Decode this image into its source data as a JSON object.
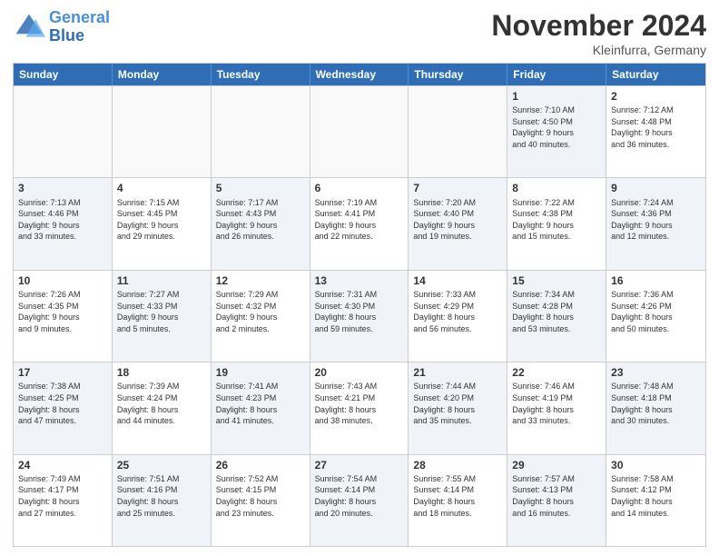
{
  "header": {
    "logo_line1": "General",
    "logo_line2": "Blue",
    "month_title": "November 2024",
    "location": "Kleinfurra, Germany"
  },
  "weekdays": [
    "Sunday",
    "Monday",
    "Tuesday",
    "Wednesday",
    "Thursday",
    "Friday",
    "Saturday"
  ],
  "rows": [
    [
      {
        "day": "",
        "info": "",
        "empty": true
      },
      {
        "day": "",
        "info": "",
        "empty": true
      },
      {
        "day": "",
        "info": "",
        "empty": true
      },
      {
        "day": "",
        "info": "",
        "empty": true
      },
      {
        "day": "",
        "info": "",
        "empty": true
      },
      {
        "day": "1",
        "info": "Sunrise: 7:10 AM\nSunset: 4:50 PM\nDaylight: 9 hours\nand 40 minutes.",
        "shaded": true
      },
      {
        "day": "2",
        "info": "Sunrise: 7:12 AM\nSunset: 4:48 PM\nDaylight: 9 hours\nand 36 minutes.",
        "shaded": false
      }
    ],
    [
      {
        "day": "3",
        "info": "Sunrise: 7:13 AM\nSunset: 4:46 PM\nDaylight: 9 hours\nand 33 minutes.",
        "shaded": true
      },
      {
        "day": "4",
        "info": "Sunrise: 7:15 AM\nSunset: 4:45 PM\nDaylight: 9 hours\nand 29 minutes.",
        "shaded": false
      },
      {
        "day": "5",
        "info": "Sunrise: 7:17 AM\nSunset: 4:43 PM\nDaylight: 9 hours\nand 26 minutes.",
        "shaded": true
      },
      {
        "day": "6",
        "info": "Sunrise: 7:19 AM\nSunset: 4:41 PM\nDaylight: 9 hours\nand 22 minutes.",
        "shaded": false
      },
      {
        "day": "7",
        "info": "Sunrise: 7:20 AM\nSunset: 4:40 PM\nDaylight: 9 hours\nand 19 minutes.",
        "shaded": true
      },
      {
        "day": "8",
        "info": "Sunrise: 7:22 AM\nSunset: 4:38 PM\nDaylight: 9 hours\nand 15 minutes.",
        "shaded": false
      },
      {
        "day": "9",
        "info": "Sunrise: 7:24 AM\nSunset: 4:36 PM\nDaylight: 9 hours\nand 12 minutes.",
        "shaded": true
      }
    ],
    [
      {
        "day": "10",
        "info": "Sunrise: 7:26 AM\nSunset: 4:35 PM\nDaylight: 9 hours\nand 9 minutes.",
        "shaded": false
      },
      {
        "day": "11",
        "info": "Sunrise: 7:27 AM\nSunset: 4:33 PM\nDaylight: 9 hours\nand 5 minutes.",
        "shaded": true
      },
      {
        "day": "12",
        "info": "Sunrise: 7:29 AM\nSunset: 4:32 PM\nDaylight: 9 hours\nand 2 minutes.",
        "shaded": false
      },
      {
        "day": "13",
        "info": "Sunrise: 7:31 AM\nSunset: 4:30 PM\nDaylight: 8 hours\nand 59 minutes.",
        "shaded": true
      },
      {
        "day": "14",
        "info": "Sunrise: 7:33 AM\nSunset: 4:29 PM\nDaylight: 8 hours\nand 56 minutes.",
        "shaded": false
      },
      {
        "day": "15",
        "info": "Sunrise: 7:34 AM\nSunset: 4:28 PM\nDaylight: 8 hours\nand 53 minutes.",
        "shaded": true
      },
      {
        "day": "16",
        "info": "Sunrise: 7:36 AM\nSunset: 4:26 PM\nDaylight: 8 hours\nand 50 minutes.",
        "shaded": false
      }
    ],
    [
      {
        "day": "17",
        "info": "Sunrise: 7:38 AM\nSunset: 4:25 PM\nDaylight: 8 hours\nand 47 minutes.",
        "shaded": true
      },
      {
        "day": "18",
        "info": "Sunrise: 7:39 AM\nSunset: 4:24 PM\nDaylight: 8 hours\nand 44 minutes.",
        "shaded": false
      },
      {
        "day": "19",
        "info": "Sunrise: 7:41 AM\nSunset: 4:23 PM\nDaylight: 8 hours\nand 41 minutes.",
        "shaded": true
      },
      {
        "day": "20",
        "info": "Sunrise: 7:43 AM\nSunset: 4:21 PM\nDaylight: 8 hours\nand 38 minutes.",
        "shaded": false
      },
      {
        "day": "21",
        "info": "Sunrise: 7:44 AM\nSunset: 4:20 PM\nDaylight: 8 hours\nand 35 minutes.",
        "shaded": true
      },
      {
        "day": "22",
        "info": "Sunrise: 7:46 AM\nSunset: 4:19 PM\nDaylight: 8 hours\nand 33 minutes.",
        "shaded": false
      },
      {
        "day": "23",
        "info": "Sunrise: 7:48 AM\nSunset: 4:18 PM\nDaylight: 8 hours\nand 30 minutes.",
        "shaded": true
      }
    ],
    [
      {
        "day": "24",
        "info": "Sunrise: 7:49 AM\nSunset: 4:17 PM\nDaylight: 8 hours\nand 27 minutes.",
        "shaded": false
      },
      {
        "day": "25",
        "info": "Sunrise: 7:51 AM\nSunset: 4:16 PM\nDaylight: 8 hours\nand 25 minutes.",
        "shaded": true
      },
      {
        "day": "26",
        "info": "Sunrise: 7:52 AM\nSunset: 4:15 PM\nDaylight: 8 hours\nand 23 minutes.",
        "shaded": false
      },
      {
        "day": "27",
        "info": "Sunrise: 7:54 AM\nSunset: 4:14 PM\nDaylight: 8 hours\nand 20 minutes.",
        "shaded": true
      },
      {
        "day": "28",
        "info": "Sunrise: 7:55 AM\nSunset: 4:14 PM\nDaylight: 8 hours\nand 18 minutes.",
        "shaded": false
      },
      {
        "day": "29",
        "info": "Sunrise: 7:57 AM\nSunset: 4:13 PM\nDaylight: 8 hours\nand 16 minutes.",
        "shaded": true
      },
      {
        "day": "30",
        "info": "Sunrise: 7:58 AM\nSunset: 4:12 PM\nDaylight: 8 hours\nand 14 minutes.",
        "shaded": false
      }
    ]
  ]
}
